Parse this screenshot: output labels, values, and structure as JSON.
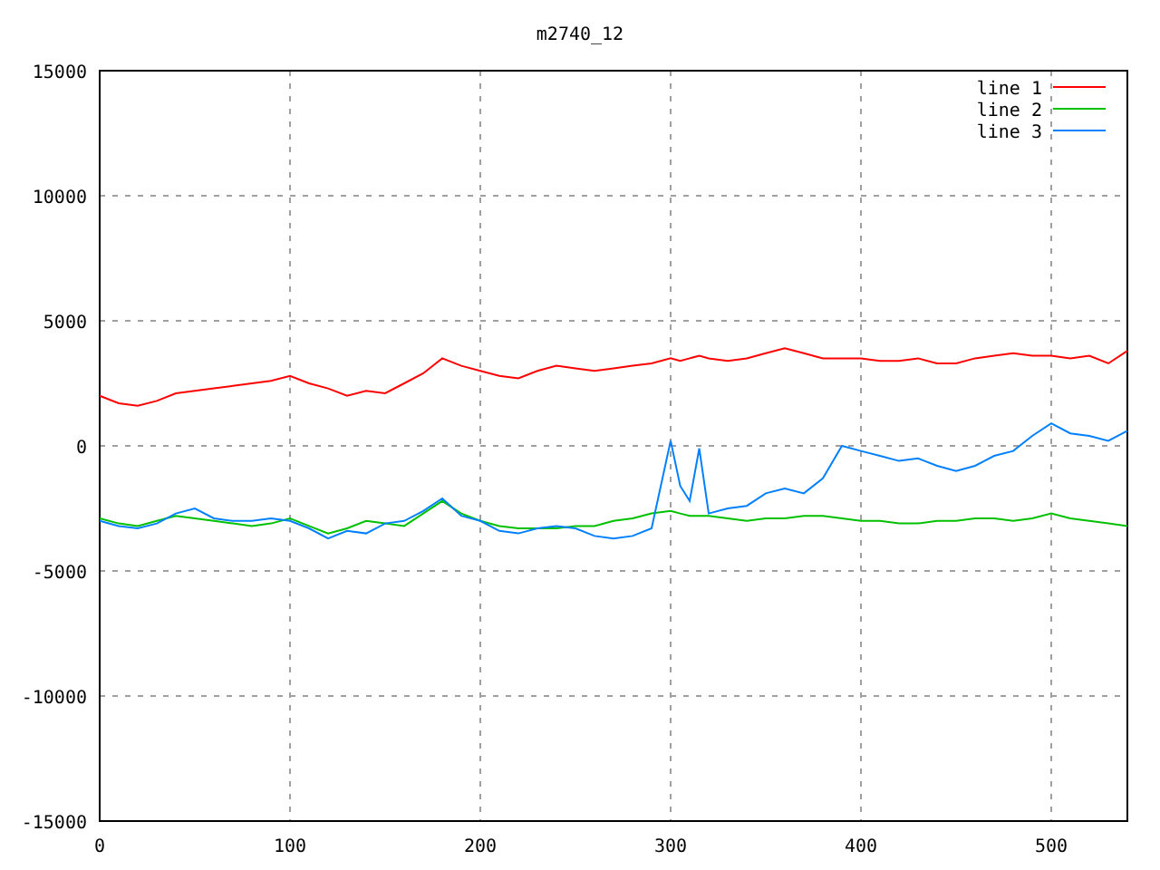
{
  "chart_data": {
    "type": "line",
    "title": "m2740_12",
    "x": [
      0,
      10,
      20,
      30,
      40,
      50,
      60,
      70,
      80,
      90,
      100,
      110,
      120,
      130,
      140,
      150,
      160,
      170,
      180,
      190,
      200,
      210,
      220,
      230,
      240,
      250,
      260,
      270,
      280,
      290,
      300,
      305,
      310,
      315,
      320,
      330,
      340,
      350,
      360,
      370,
      380,
      390,
      400,
      410,
      420,
      430,
      440,
      450,
      460,
      470,
      480,
      490,
      500,
      510,
      520,
      530,
      540
    ],
    "series": [
      {
        "name": "line 1",
        "color": "#ff0000",
        "values": [
          2000,
          1700,
          1600,
          1800,
          2100,
          2200,
          2300,
          2400,
          2500,
          2600,
          2800,
          2500,
          2300,
          2000,
          2200,
          2100,
          2500,
          2900,
          3500,
          3200,
          3000,
          2800,
          2700,
          3000,
          3200,
          3100,
          3000,
          3100,
          3200,
          3300,
          3500,
          3400,
          3500,
          3600,
          3500,
          3400,
          3500,
          3700,
          3900,
          3700,
          3500,
          3500,
          3500,
          3400,
          3400,
          3500,
          3300,
          3300,
          3500,
          3600,
          3700,
          3600,
          3600,
          3500,
          3600,
          3300,
          3800
        ]
      },
      {
        "name": "line 2",
        "color": "#00c000",
        "values": [
          -2900,
          -3100,
          -3200,
          -3000,
          -2800,
          -2900,
          -3000,
          -3100,
          -3200,
          -3100,
          -2900,
          -3200,
          -3500,
          -3300,
          -3000,
          -3100,
          -3200,
          -2700,
          -2200,
          -2700,
          -3000,
          -3200,
          -3300,
          -3300,
          -3300,
          -3200,
          -3200,
          -3000,
          -2900,
          -2700,
          -2600,
          -2700,
          -2800,
          -2800,
          -2800,
          -2900,
          -3000,
          -2900,
          -2900,
          -2800,
          -2800,
          -2900,
          -3000,
          -3000,
          -3100,
          -3100,
          -3000,
          -3000,
          -2900,
          -2900,
          -3000,
          -2900,
          -2700,
          -2900,
          -3000,
          -3100,
          -3200
        ]
      },
      {
        "name": "line 3",
        "color": "#0080ff",
        "values": [
          -3000,
          -3200,
          -3300,
          -3100,
          -2700,
          -2500,
          -2900,
          -3000,
          -3000,
          -2900,
          -3000,
          -3300,
          -3700,
          -3400,
          -3500,
          -3100,
          -3000,
          -2600,
          -2100,
          -2800,
          -3000,
          -3400,
          -3500,
          -3300,
          -3200,
          -3300,
          -3600,
          -3700,
          -3600,
          -3300,
          200,
          -1600,
          -2200,
          -100,
          -2700,
          -2500,
          -2400,
          -1900,
          -1700,
          -1900,
          -1300,
          0,
          -200,
          -400,
          -600,
          -500,
          -800,
          -1000,
          -800,
          -400,
          -200,
          400,
          900,
          500,
          400,
          200,
          600
        ]
      }
    ],
    "xlim": [
      0,
      540
    ],
    "ylim": [
      -15000,
      15000
    ],
    "xticks": [
      0,
      100,
      200,
      300,
      400,
      500
    ],
    "yticks": [
      -15000,
      -10000,
      -5000,
      0,
      5000,
      10000,
      15000
    ],
    "grid": true,
    "legend": true
  }
}
